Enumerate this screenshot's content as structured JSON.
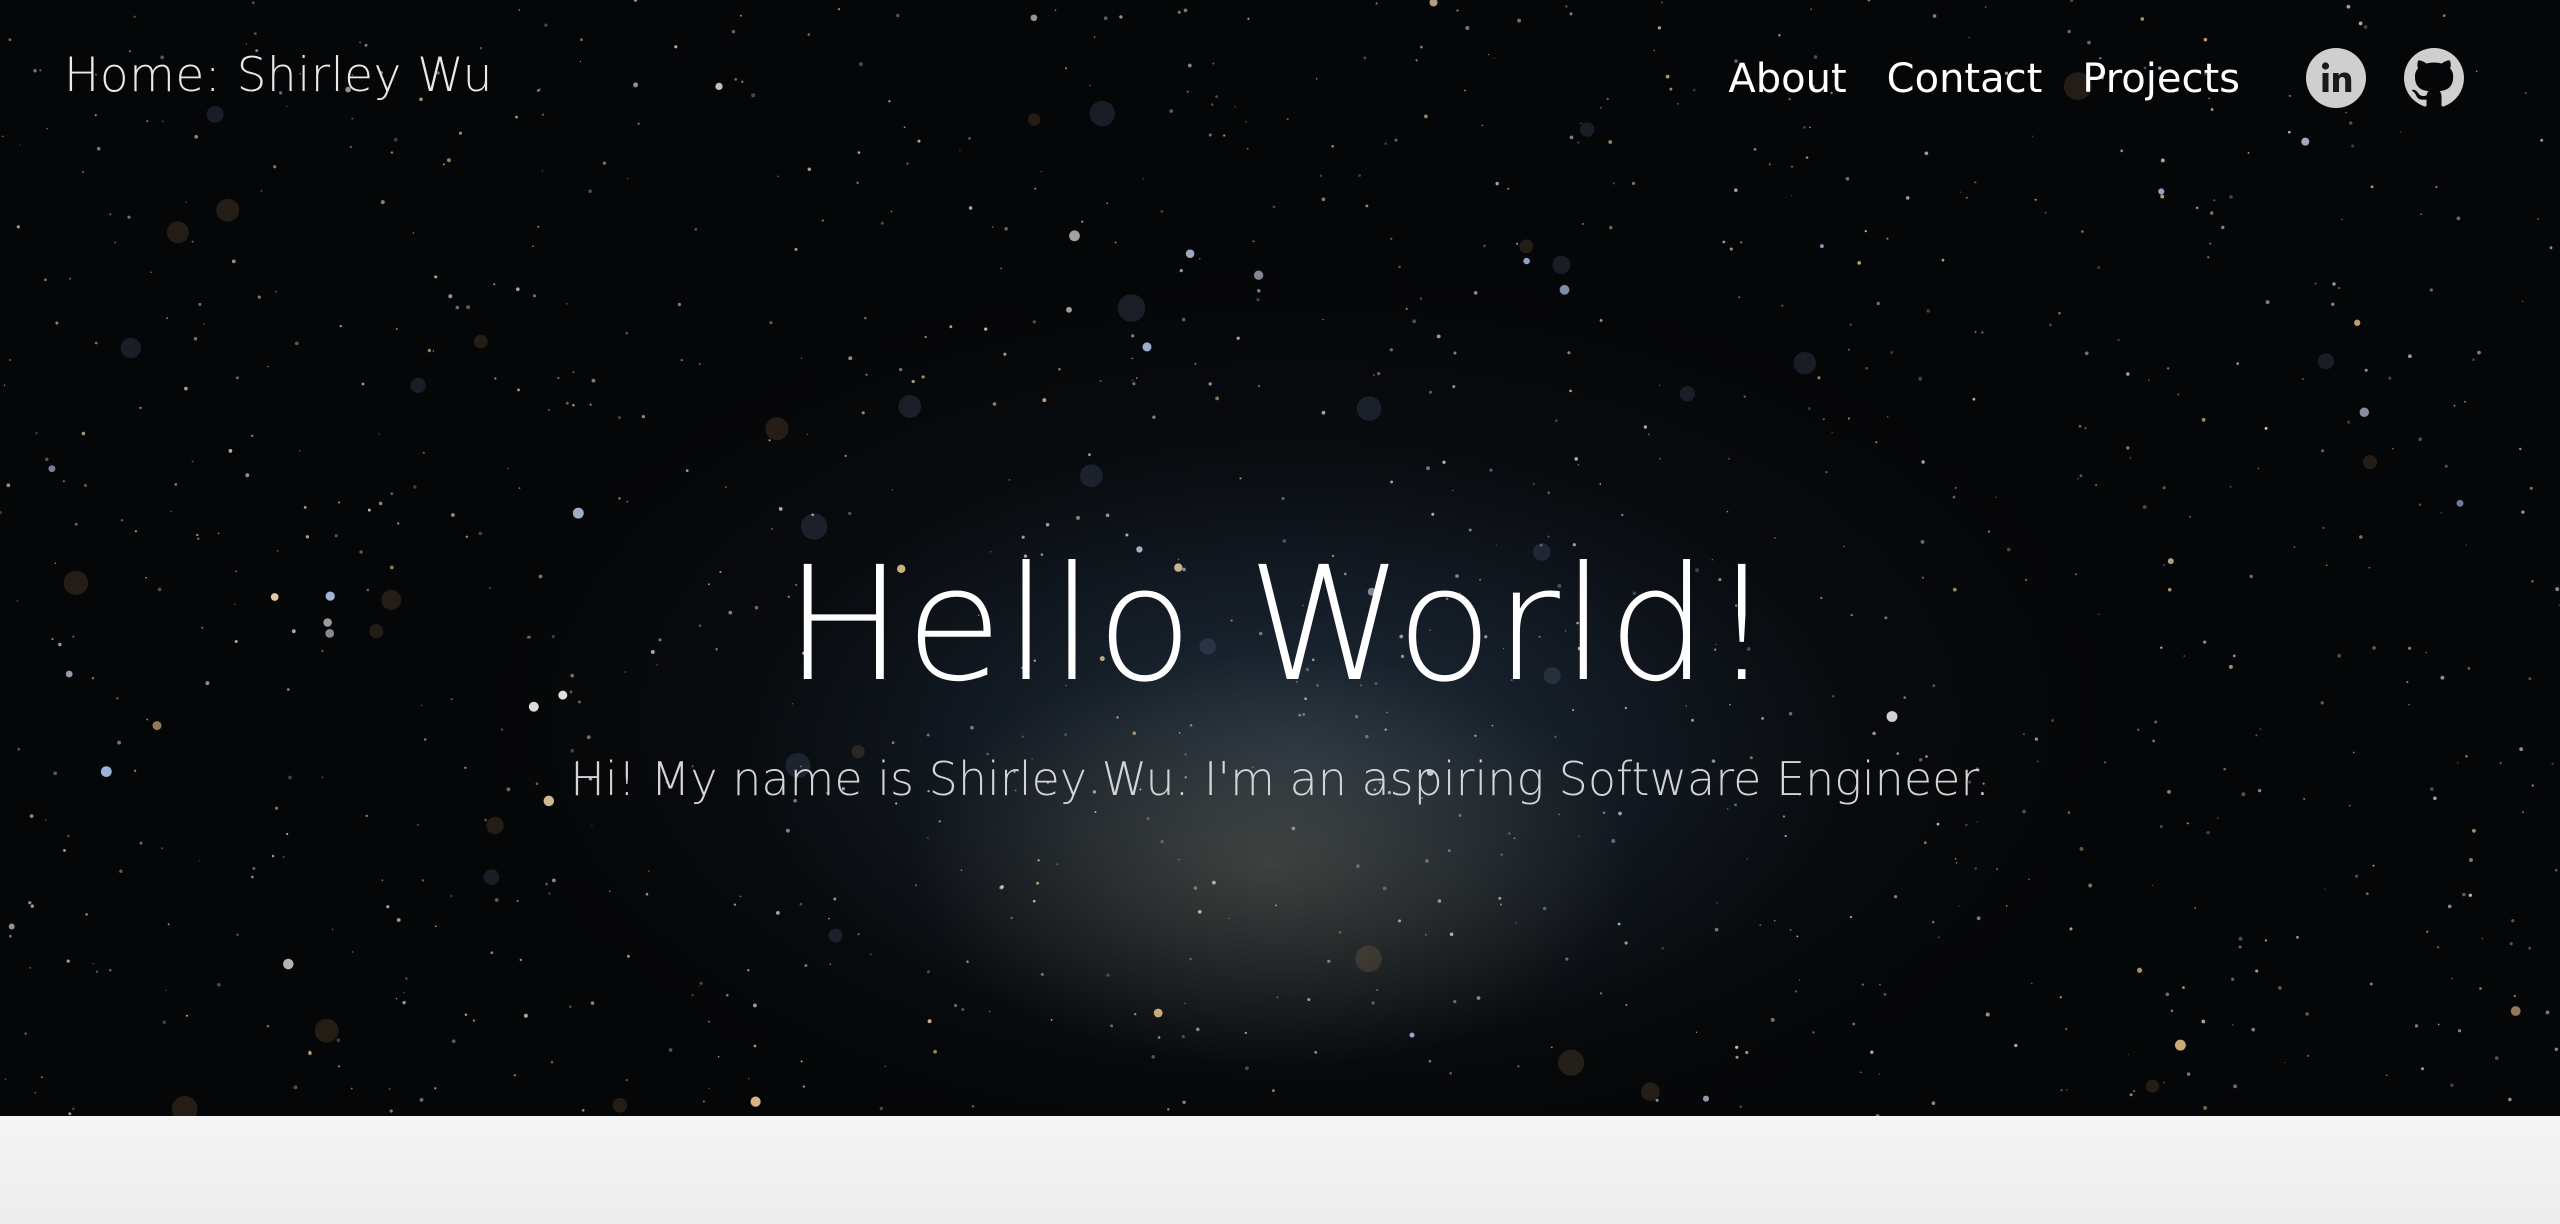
{
  "nav": {
    "brand": "Home: Shirley Wu",
    "links": [
      {
        "label": "About"
      },
      {
        "label": "Contact"
      },
      {
        "label": "Projects"
      }
    ],
    "social": {
      "linkedin_icon": "linkedin-icon",
      "github_icon": "github-icon"
    }
  },
  "hero": {
    "headline": "Hello World!",
    "tagline": "Hi! My name is Shirley Wu. I'm an aspiring Software Engineer."
  },
  "colors": {
    "background": "#050607",
    "text": "#ffffff",
    "icon": "#cfcfcf",
    "below_section": "#f3f3f3"
  }
}
